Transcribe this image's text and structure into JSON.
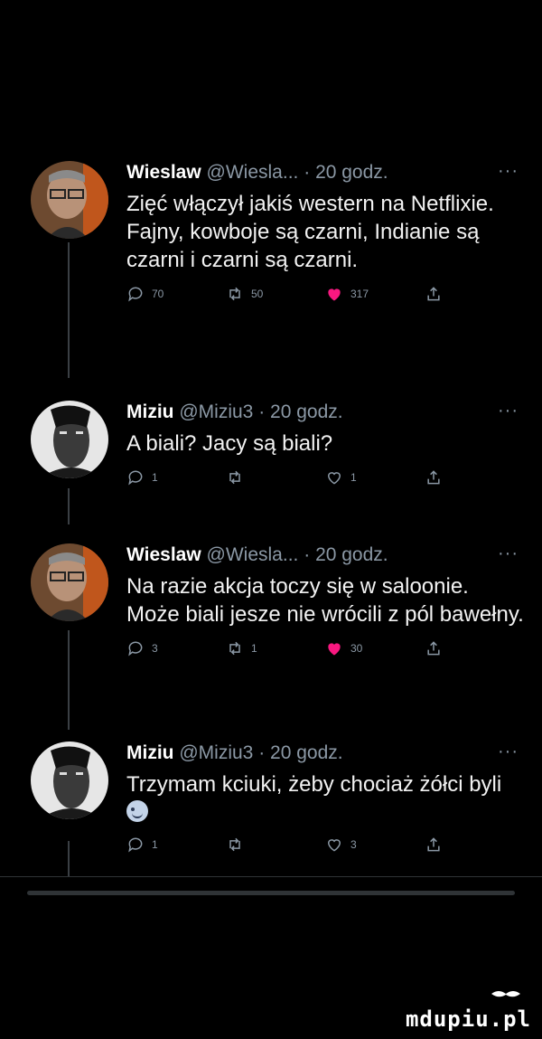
{
  "tweets": [
    {
      "name": "Wieslaw",
      "handle": "@Wiesla...",
      "time": "20 godz.",
      "text": "Zięć włączył jakiś western na Netflixie. Fajny, kowboje są czarni, Indianie są czarni i czarni są czarni.",
      "replies": "70",
      "retweets": "50",
      "likes": "317",
      "liked": true
    },
    {
      "name": "Miziu",
      "handle": "@Miziu3",
      "time": "20 godz.",
      "text": "A biali? Jacy są biali?",
      "replies": "1",
      "retweets": "",
      "likes": "1",
      "liked": false
    },
    {
      "name": "Wieslaw",
      "handle": "@Wiesla...",
      "time": "20 godz.",
      "text": "Na razie akcja toczy się w saloonie. Może biali jesze nie wrócili z pól bawełny.",
      "replies": "3",
      "retweets": "1",
      "likes": "30",
      "liked": true
    },
    {
      "name": "Miziu",
      "handle": "@Miziu3",
      "time": "20 godz.",
      "text": "Trzymam kciuki, żeby chociaż żółci byli",
      "replies": "1",
      "retweets": "",
      "likes": "3",
      "liked": false
    }
  ],
  "separator": "·",
  "more": "···",
  "watermark": "mdupiu.pl",
  "colors": {
    "like": "#f91880",
    "muted": "#8b98a5",
    "background": "#000000"
  }
}
